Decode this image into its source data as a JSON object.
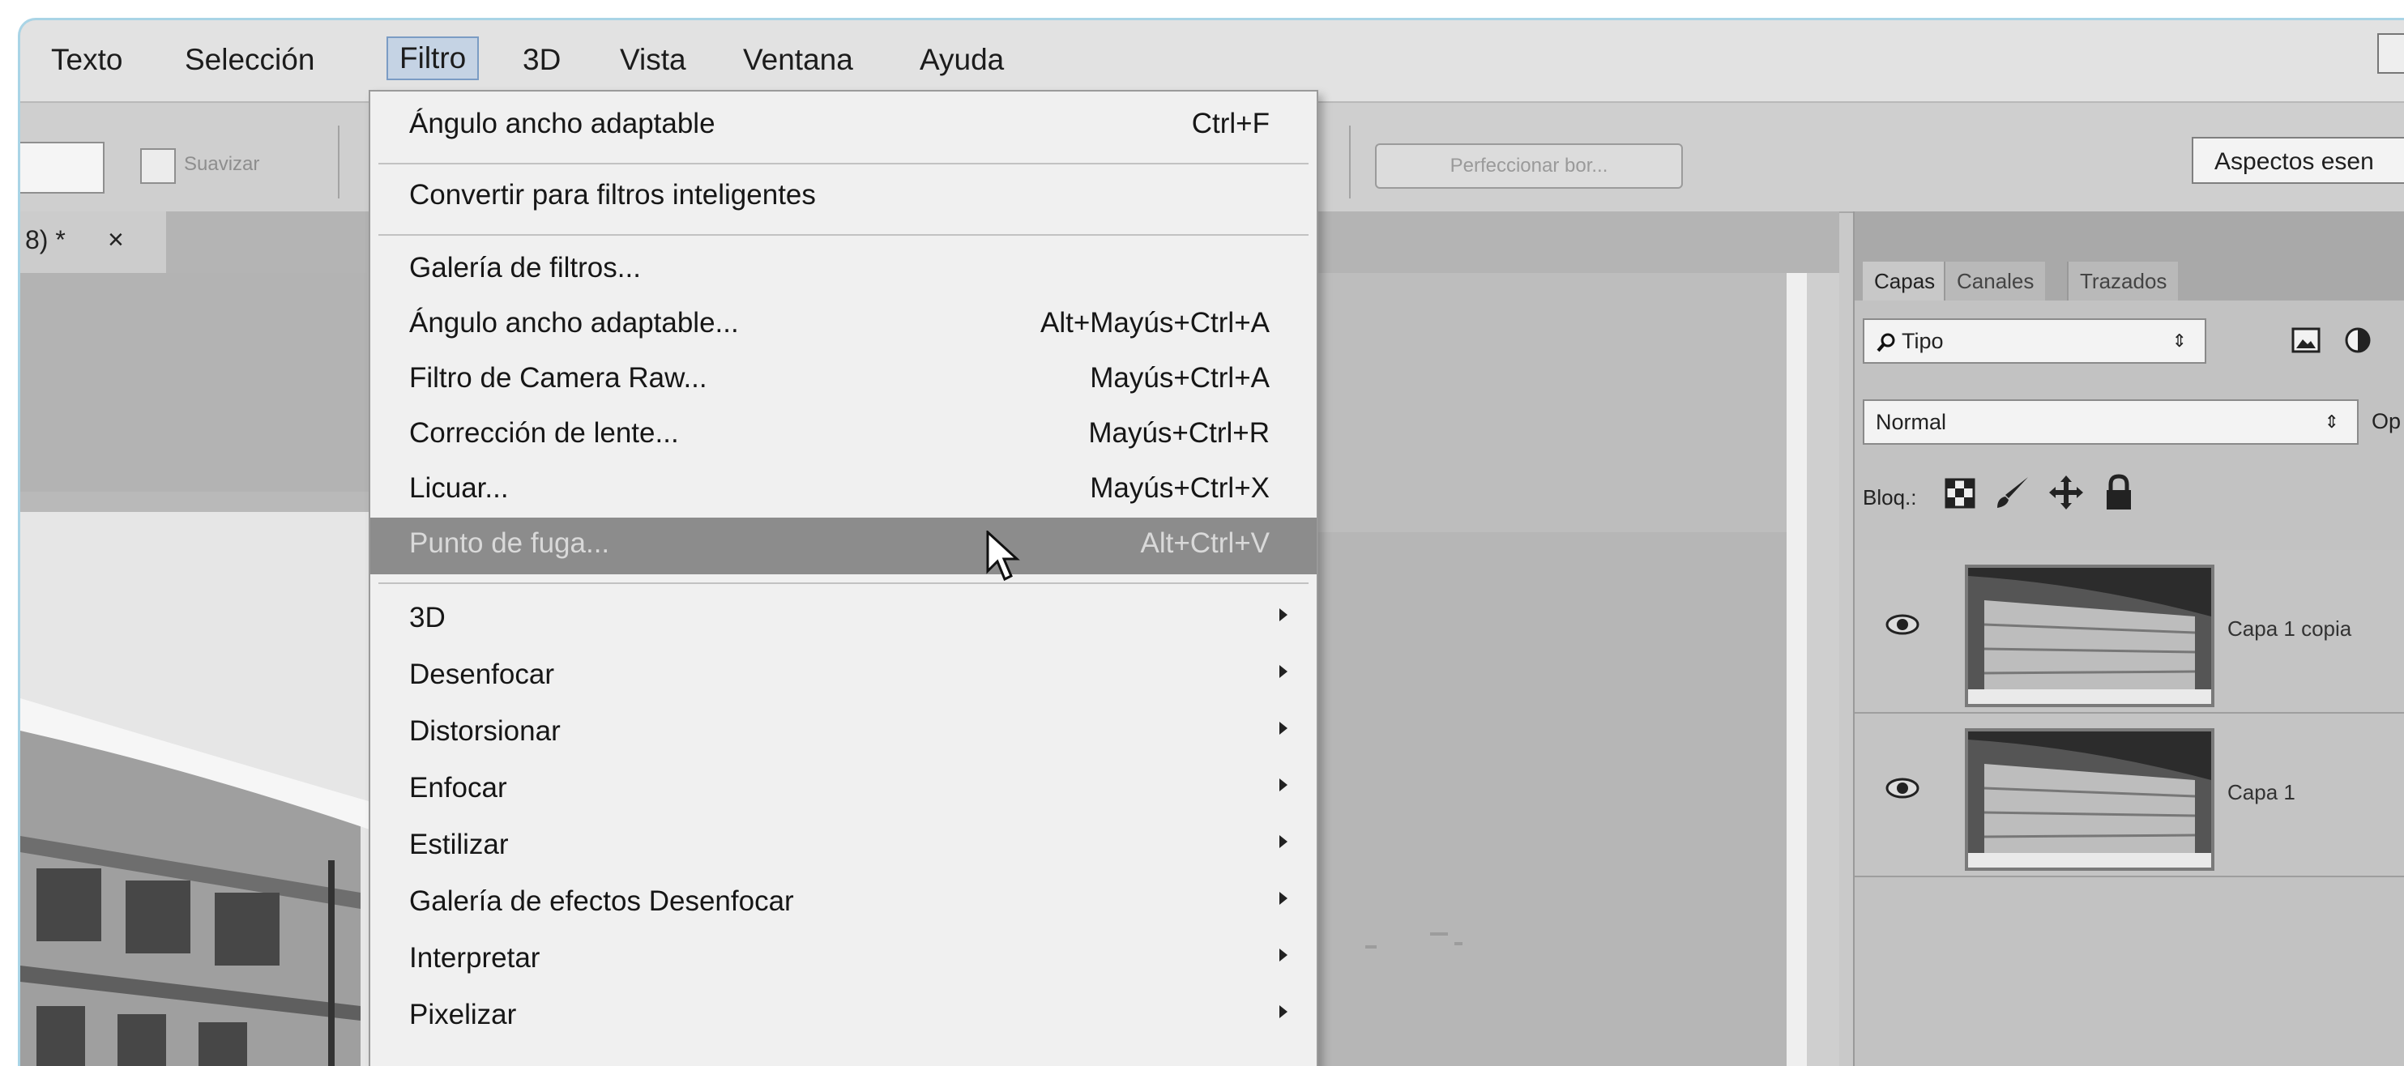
{
  "menubar": {
    "items": [
      "Texto",
      "Selección",
      "Filtro",
      "3D",
      "Vista",
      "Ventana",
      "Ayuda"
    ],
    "active": "Filtro"
  },
  "options_bar": {
    "suavizar_label": "Suavizar",
    "refine_button": "Perfeccionar bor...",
    "workspace": "Aspectos esen"
  },
  "document": {
    "tab_label": "8) *",
    "tab_close": "×"
  },
  "filter_menu": {
    "items": [
      {
        "label": "Ángulo ancho adaptable",
        "shortcut": "Ctrl+F"
      },
      {
        "label": "Convertir para filtros inteligentes",
        "shortcut": ""
      },
      {
        "label": "Galería de filtros...",
        "shortcut": ""
      },
      {
        "label": "Ángulo ancho adaptable...",
        "shortcut": "Alt+Mayús+Ctrl+A"
      },
      {
        "label": "Filtro de Camera Raw...",
        "shortcut": "Mayús+Ctrl+A"
      },
      {
        "label": "Corrección de lente...",
        "shortcut": "Mayús+Ctrl+R"
      },
      {
        "label": "Licuar...",
        "shortcut": "Mayús+Ctrl+X"
      },
      {
        "label": "Punto de fuga...",
        "shortcut": "Alt+Ctrl+V",
        "highlighted": true
      },
      {
        "label": "3D",
        "submenu": true
      },
      {
        "label": "Desenfocar",
        "submenu": true
      },
      {
        "label": "Distorsionar",
        "submenu": true
      },
      {
        "label": "Enfocar",
        "submenu": true
      },
      {
        "label": "Estilizar",
        "submenu": true
      },
      {
        "label": "Galería de efectos Desenfocar",
        "submenu": true
      },
      {
        "label": "Interpretar",
        "submenu": true
      },
      {
        "label": "Pixelizar",
        "submenu": true
      }
    ]
  },
  "layers_panel": {
    "tabs": [
      "Capas",
      "Canales",
      "Trazados"
    ],
    "active_tab": "Capas",
    "filter_kind": "Tipo",
    "blend_mode": "Normal",
    "opacity_label": "Op",
    "lock_label": "Bloq.:",
    "layers": [
      {
        "name": "Capa 1 copia"
      },
      {
        "name": "Capa 1"
      }
    ]
  },
  "colors": {
    "menu_highlight": "#8c8c8c",
    "active_menu_bg": "#c5d3e4",
    "window_border": "#a9d4e6"
  }
}
